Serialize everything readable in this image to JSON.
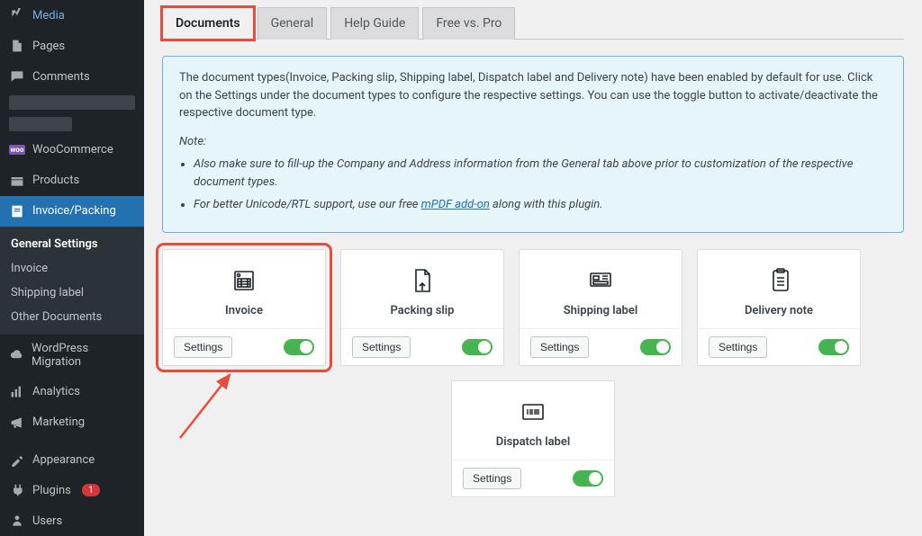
{
  "sidebar": {
    "media": "Media",
    "pages": "Pages",
    "comments": "Comments",
    "woocommerce": "WooCommerce",
    "products": "Products",
    "invoice_packing": "Invoice/Packing",
    "wp_migration": "WordPress Migration",
    "analytics": "Analytics",
    "marketing": "Marketing",
    "appearance": "Appearance",
    "plugins": "Plugins",
    "plugins_badge": "1",
    "users": "Users",
    "sub": {
      "general": "General Settings",
      "invoice": "Invoice",
      "shipping": "Shipping label",
      "other": "Other Documents"
    }
  },
  "tabs": {
    "documents": "Documents",
    "general": "General",
    "help": "Help Guide",
    "freepro": "Free vs. Pro"
  },
  "notice": {
    "intro": "The document types(Invoice, Packing slip, Shipping label, Dispatch label and Delivery note) have been enabled by default for use. Click on the Settings under the document types to configure the respective settings. You can use the toggle button to activate/deactivate the respective document type.",
    "note_label": "Note:",
    "li1": "Also make sure to fill-up the Company and Address information from the General tab above prior to customization of the respective document types.",
    "li2a": "For better Unicode/RTL support, use our free ",
    "li2_link": "mPDF add-on",
    "li2b": " along with this plugin."
  },
  "cards": {
    "invoice": "Invoice",
    "packing": "Packing slip",
    "shipping": "Shipping label",
    "delivery": "Delivery note",
    "dispatch": "Dispatch label",
    "settings": "Settings"
  }
}
